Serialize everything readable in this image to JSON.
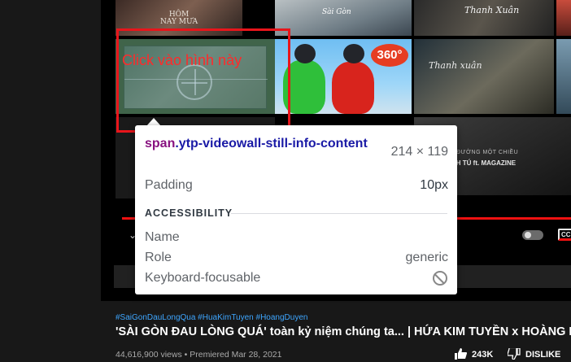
{
  "annotation": {
    "text": "Click vào hình này",
    "color": "#e8151b"
  },
  "thumbnails": {
    "hom_nay_mua": "HÔM\nNAY MƯA",
    "song_title": "Sài Gòn",
    "thanh_xuan_top": "Thanh Xuân",
    "thanh_xuan_mid": "Thanh xuân",
    "badge_360": "360°",
    "duong_mot_chieu": "ĐƯỜNG MỘT CHIỀU",
    "magazine": "NH TÚ ft. MAGAZINE"
  },
  "player": {
    "progress_fraction": 1.0,
    "cc_label": "CC"
  },
  "tooltip": {
    "selector_tag": "span",
    "selector_class": ".ytp-videowall-still-info-content",
    "dimensions": "214 × 119",
    "padding_label": "Padding",
    "padding_value": "10px",
    "section_title": "ACCESSIBILITY",
    "rows": [
      {
        "label": "Name",
        "value": ""
      },
      {
        "label": "Role",
        "value": "generic"
      },
      {
        "label": "Keyboard-focusable",
        "value": "",
        "icon": "not-allowed-icon"
      }
    ]
  },
  "video": {
    "hashtags": "#SaiGonDauLongQua #HuaKimTuyen #HoangDuyen",
    "title": "'SÀI GÒN ĐAU LÒNG QUÁ' toàn kỷ niệm chúng ta... | HỨA KIM TUYỀN x HOÀNG DU",
    "stats": "44,616,900 views • Premiered Mar 28, 2021",
    "like_count": "243K",
    "dislike_label": "DISLIKE"
  }
}
